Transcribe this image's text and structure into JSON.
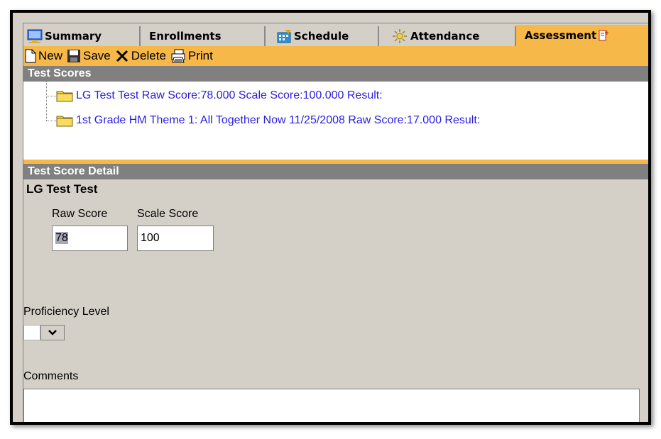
{
  "tabs": [
    {
      "label": "Summary",
      "icon": "summary-icon"
    },
    {
      "label": "Enrollments",
      "icon": ""
    },
    {
      "label": "Schedule",
      "icon": "schedule-icon"
    },
    {
      "label": "Attendance",
      "icon": "attendance-icon"
    },
    {
      "label": "Assessment",
      "icon": "assessment-icon",
      "active": true
    }
  ],
  "toolbar": {
    "new_label": "New",
    "save_label": "Save",
    "delete_label": "Delete",
    "print_label": "Print"
  },
  "test_scores": {
    "header": "Test Scores",
    "items": [
      {
        "label": "LG Test Test Raw Score:78.000 Scale Score:100.000 Result:"
      },
      {
        "label": "1st Grade HM Theme 1: All Together Now 11/25/2008 Raw Score:17.000 Result:"
      }
    ]
  },
  "detail": {
    "header": "Test Score Detail",
    "title": "LG Test Test",
    "raw_score_label": "Raw Score",
    "raw_score_value": "78",
    "scale_score_label": "Scale Score",
    "scale_score_value": "100",
    "proficiency_label": "Proficiency Level",
    "proficiency_value": "",
    "comments_label": "Comments",
    "comments_value": ""
  },
  "colors": {
    "accent": "#f7b84a",
    "header_bg": "#808080",
    "link": "#2a1fe0",
    "panel_bg": "#d4d0c8"
  }
}
